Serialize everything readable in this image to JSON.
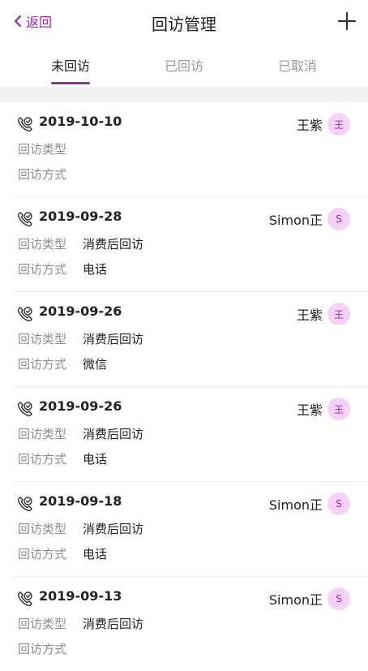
{
  "nav": {
    "back_label": "返回",
    "title": "回访管理"
  },
  "tabs": [
    {
      "label": "未回访"
    },
    {
      "label": "已回访"
    },
    {
      "label": "已取消"
    }
  ],
  "colors": {
    "accent": "#9c27b0",
    "avatar_bg": "#f6d2fb",
    "muted": "#8c8c8c"
  },
  "fields": {
    "type_label": "回访类型",
    "method_label": "回访方式"
  },
  "visits": [
    {
      "date": "2019-10-10",
      "name": "王紫",
      "avatar": "王",
      "type": "",
      "method": ""
    },
    {
      "date": "2019-09-28",
      "name": "Simon正",
      "avatar": "S",
      "type": "消费后回访",
      "method": "电话"
    },
    {
      "date": "2019-09-26",
      "name": "王紫",
      "avatar": "王",
      "type": "消费后回访",
      "method": "微信"
    },
    {
      "date": "2019-09-26",
      "name": "王紫",
      "avatar": "王",
      "type": "消费后回访",
      "method": "电话"
    },
    {
      "date": "2019-09-18",
      "name": "Simon正",
      "avatar": "S",
      "type": "消费后回访",
      "method": "电话"
    },
    {
      "date": "2019-09-13",
      "name": "Simon正",
      "avatar": "S",
      "type": "消费后回访",
      "method": ""
    }
  ]
}
